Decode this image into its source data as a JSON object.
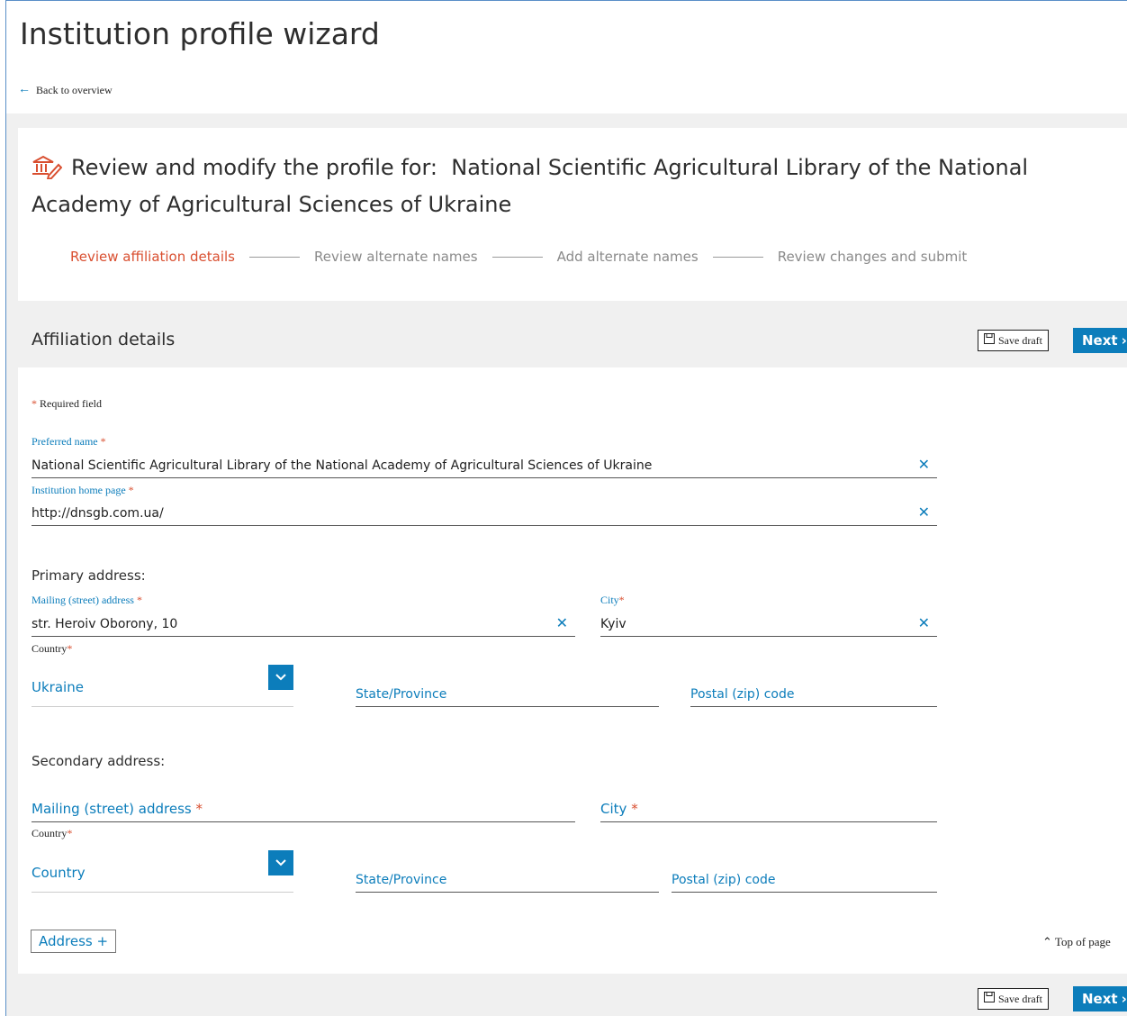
{
  "header": {
    "title": "Institution profile wizard",
    "back_link": "Back to overview"
  },
  "review": {
    "prefix": "Review and modify the profile for:",
    "institution": "National Scientific Agricultural Library of the National Academy of Agricultural Sciences of Ukraine"
  },
  "steps": [
    {
      "label": "Review affiliation details",
      "active": true
    },
    {
      "label": "Review alternate names",
      "active": false
    },
    {
      "label": "Add alternate names",
      "active": false
    },
    {
      "label": "Review changes and submit",
      "active": false
    }
  ],
  "section": {
    "title": "Affiliation details",
    "save_label": "Save draft",
    "next_label": "Next"
  },
  "form": {
    "required_note": "Required field",
    "preferred_name": {
      "label": "Preferred name",
      "value": "National Scientific Agricultural Library of the National Academy of Agricultural Sciences of Ukraine"
    },
    "home_page": {
      "label": "Institution home page",
      "value": "http://dnsgb.com.ua/"
    },
    "primary": {
      "heading": "Primary address:",
      "street_label": "Mailing (street) address",
      "street_value": "str. Heroiv Oborony, 10",
      "city_label": "City",
      "city_value": "Kyiv",
      "country_label": "Country",
      "country_value": "Ukraine",
      "state_placeholder": "State/Province",
      "postal_placeholder": "Postal (zip) code"
    },
    "secondary": {
      "heading": "Secondary address:",
      "street_placeholder": "Mailing (street) address",
      "city_placeholder": "City",
      "country_label": "Country",
      "country_value": "Country",
      "state_placeholder": "State/Province",
      "postal_placeholder": "Postal (zip) code"
    },
    "add_address_label": "Address +",
    "top_of_page_label": "Top of page"
  },
  "colors": {
    "accent": "#0c7dbb",
    "active_step": "#d94f30",
    "band": "#f0f0f0"
  }
}
